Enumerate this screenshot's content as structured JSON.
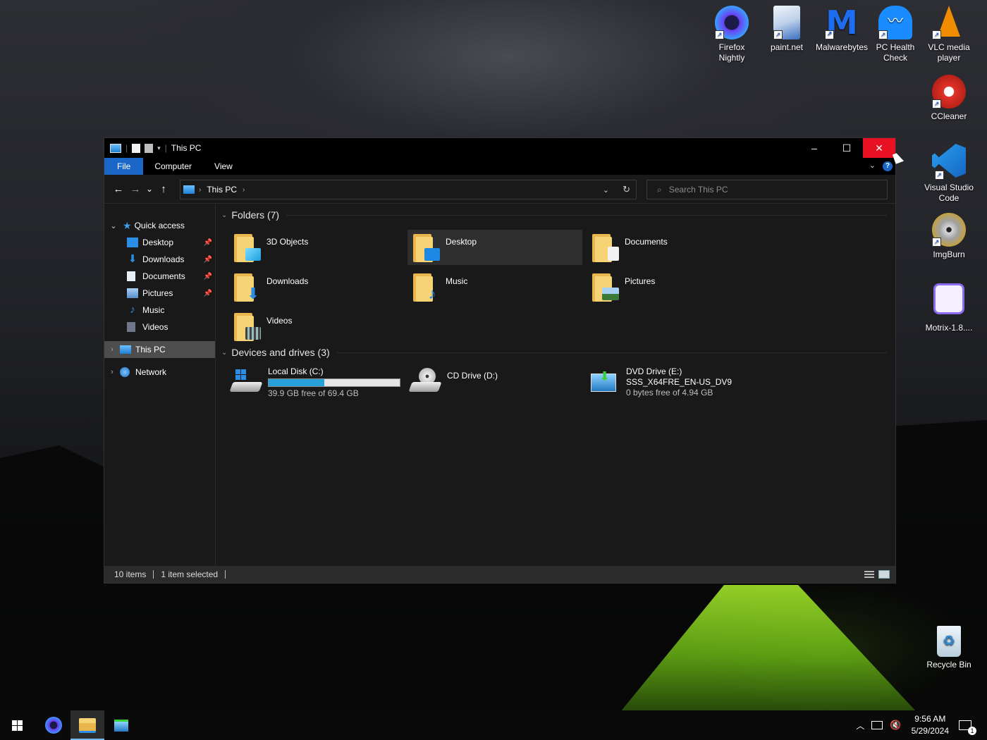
{
  "desktop": {
    "icons": [
      {
        "label": "Firefox Nightly",
        "icon": "firefox-nightly-icon",
        "color": "#5b3df0"
      },
      {
        "label": "paint.net",
        "icon": "paintnet-icon",
        "color": "#3b78d8"
      },
      {
        "label": "Malwarebytes",
        "icon": "malwarebytes-icon",
        "color": "#1e6df0"
      },
      {
        "label": "PC Health Check",
        "icon": "pc-health-check-icon",
        "color": "#1a8cff"
      },
      {
        "label": "VLC media player",
        "icon": "vlc-icon",
        "color": "#f08c00"
      },
      {
        "label": "CCleaner",
        "icon": "ccleaner-icon",
        "color": "#e0342a"
      },
      {
        "label": "Visual Studio Code",
        "icon": "vscode-icon",
        "color": "#1f8ad2"
      },
      {
        "label": "ImgBurn",
        "icon": "imgburn-icon",
        "color": "#c8a030"
      },
      {
        "label": "Motrix-1.8....",
        "icon": "motrix-icon",
        "color": "#8a6cf0"
      },
      {
        "label": "Recycle Bin",
        "icon": "recycle-bin-icon",
        "color": "#d9e6ee"
      }
    ]
  },
  "window": {
    "title": "This PC",
    "controls": {
      "minimize": "–",
      "maximize": "☐",
      "close": "✕"
    },
    "close_color": "#e81123"
  },
  "ribbon": {
    "tabs": [
      "File",
      "Computer",
      "View"
    ],
    "help": "?"
  },
  "nav": {
    "back": "←",
    "forward": "→",
    "recent": "⌄",
    "up": "↑",
    "address": "This PC",
    "refresh": "↻",
    "search_placeholder": "Search This PC"
  },
  "sidebar": {
    "quick_access": "Quick access",
    "items": [
      {
        "label": "Desktop",
        "pinned": true
      },
      {
        "label": "Downloads",
        "pinned": true
      },
      {
        "label": "Documents",
        "pinned": true
      },
      {
        "label": "Pictures",
        "pinned": true
      },
      {
        "label": "Music",
        "pinned": false
      },
      {
        "label": "Videos",
        "pinned": false
      }
    ],
    "this_pc": "This PC",
    "network": "Network"
  },
  "content": {
    "folders_header": "Folders (7)",
    "folders": [
      "3D Objects",
      "Desktop",
      "Documents",
      "Downloads",
      "Music",
      "Pictures",
      "Videos"
    ],
    "drives_header": "Devices and drives (3)",
    "drives": [
      {
        "name": "Local Disk (C:)",
        "detail": "39.9 GB free of 69.4 GB",
        "used_fraction": 0.425
      },
      {
        "name": "CD Drive (D:)",
        "detail": ""
      },
      {
        "name": "DVD Drive (E:)",
        "label": "SSS_X64FRE_EN-US_DV9",
        "detail": "0 bytes free of 4.94 GB"
      }
    ]
  },
  "status": {
    "items": "10 items",
    "selected": "1 item selected"
  },
  "taskbar": {
    "time": "9:56 AM",
    "date": "5/29/2024",
    "notifications": "1"
  },
  "colors": {
    "accent": "#1a67c7",
    "selection": "#4d4d4d",
    "bar_fill": "#26a0da"
  }
}
